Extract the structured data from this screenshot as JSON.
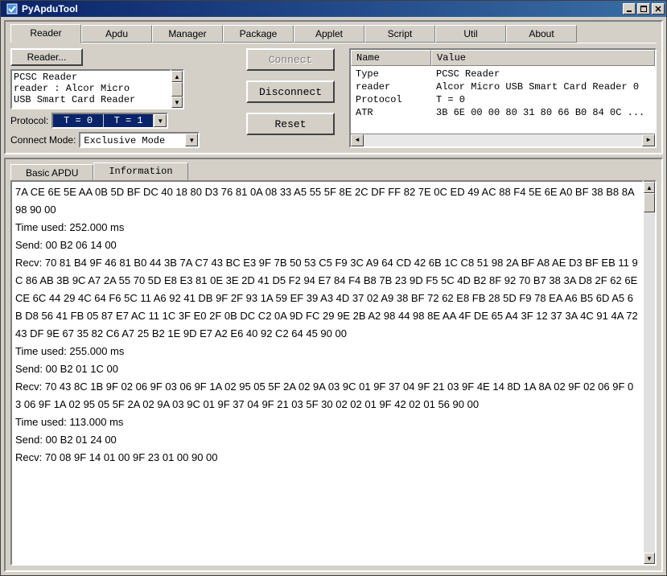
{
  "titlebar": {
    "title": "PyApduTool"
  },
  "winbuttons": {
    "min": "_",
    "max": "□",
    "close": "×"
  },
  "main_tabs": [
    "Reader",
    "Apdu",
    "Manager",
    "Package",
    "Applet",
    "Script",
    "Util",
    "About"
  ],
  "main_active_tab": 0,
  "reader_section": {
    "button_label": "Reader...",
    "list_lines": [
      "PCSC Reader",
      "reader : Alcor Micro",
      "USB Smart Card Reader"
    ],
    "protocol_label": "Protocol:",
    "protocol_options": [
      "T = 0",
      "T = 1"
    ],
    "connect_mode_label": "Connect Mode:",
    "connect_mode_value": "Exclusive Mode"
  },
  "action_buttons": {
    "connect": "Connect",
    "disconnect": "Disconnect",
    "reset": "Reset"
  },
  "info_table": {
    "headers": {
      "name": "Name",
      "value": "Value"
    },
    "rows": [
      {
        "name": "Type",
        "value": "PCSC Reader"
      },
      {
        "name": "reader",
        "value": "Alcor Micro USB Smart Card Reader 0"
      },
      {
        "name": "Protocol",
        "value": "T = 0"
      },
      {
        "name": "ATR",
        "value": "3B 6E 00 00 80 31 80 66 B0 84 0C ..."
      }
    ]
  },
  "lower_tabs": {
    "basic": "Basic APDU",
    "info": "Information"
  },
  "log_lines": [
    "7A CE 6E 5E AA 0B 5D BF DC 40 18 80 D3 76 81 0A 08 33 A5 55 5F 8E 2C DF FF 82 7E 0C ED 49 AC 88 F4 5E 6E A0 BF 38 B8 8A 98 90 00",
    "Time used: 252.000 ms",
    "Send: 00 B2 06 14 00",
    "Recv: 70 81 B4 9F 46 81 B0 44 3B 7A C7 43 BC E3 9F 7B 50 53 C5 F9 3C A9 64 CD 42 6B 1C C8 51 98 2A BF A8 AE D3 BF EB 11 9C 86 AB 3B 9C A7 2A 55 70 5D E8 E3 81 0E 3E 2D 41 D5 F2 94 E7 84 F4 B8 7B 23 9D F5 5C 4D B2 8F 92 70 B7 38 3A D8 2F 62 6E CE 6C 44 29 4C 64 F6 5C 11 A6 92 41 DB 9F 2F 93 1A 59 EF 39 A3 4D 37 02 A9 38 BF 72 62 E8 FB 28 5D F9 78 EA A6 B5 6D A5 6B D8 56 41 FB 05 87 E7 AC 11 1C 3F E0 2F 0B DC C2 0A 9D FC 29 9E 2B A2 98 44 98 8E AA 4F DE 65 A4 3F 12 37 3A 4C 91 4A 72 43 DF 9E 67 35 82 C6 A7 25 B2 1E 9D E7 A2 E6 40 92 C2 64 45 90 00",
    "Time used: 255.000 ms",
    "Send: 00 B2 01 1C 00",
    "Recv: 70 43 8C 1B 9F 02 06 9F 03 06 9F 1A 02 95 05 5F 2A 02 9A 03 9C 01 9F 37 04 9F 21 03 9F 4E 14 8D 1A 8A 02 9F 02 06 9F 03 06 9F 1A 02 95 05 5F 2A 02 9A 03 9C 01 9F 37 04 9F 21 03 5F 30 02 02 01 9F 42 02 01 56 90 00",
    "Time used: 113.000 ms",
    "Send: 00 B2 01 24 00",
    "Recv: 70 08 9F 14 01 00 9F 23 01 00 90 00"
  ]
}
